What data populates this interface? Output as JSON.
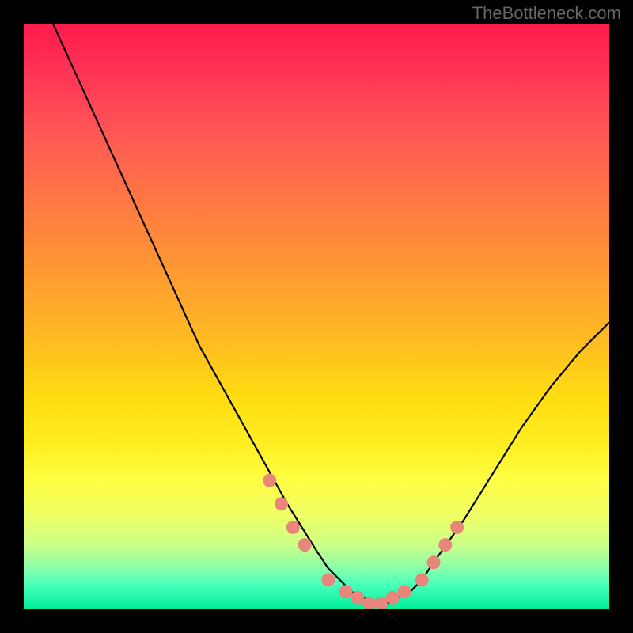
{
  "watermark": "TheBottleneck.com",
  "chart_data": {
    "type": "line",
    "title": "",
    "xlabel": "",
    "ylabel": "",
    "xlim": [
      0,
      100
    ],
    "ylim": [
      0,
      100
    ],
    "series": [
      {
        "name": "curve",
        "x": [
          5,
          10,
          15,
          20,
          25,
          30,
          35,
          40,
          45,
          50,
          52,
          54,
          56,
          58,
          60,
          62,
          64,
          66,
          68,
          70,
          75,
          80,
          85,
          90,
          95,
          100
        ],
        "values": [
          100,
          89,
          78,
          67,
          56,
          45,
          36,
          27,
          18,
          10,
          7,
          5,
          3,
          2,
          1,
          1,
          2,
          3,
          5,
          8,
          15,
          23,
          31,
          38,
          44,
          49
        ]
      }
    ],
    "markers": {
      "name": "highlight-dots",
      "x": [
        42,
        44,
        46,
        48,
        52,
        55,
        57,
        59,
        61,
        63,
        65,
        68,
        70,
        72,
        74
      ],
      "values": [
        22,
        18,
        14,
        11,
        5,
        3,
        2,
        1,
        1,
        2,
        3,
        5,
        8,
        11,
        14
      ],
      "color": "#e8867b"
    },
    "background_gradient": {
      "top": "#ff1a4d",
      "middle": "#ffdd11",
      "bottom": "#00ee99"
    }
  }
}
